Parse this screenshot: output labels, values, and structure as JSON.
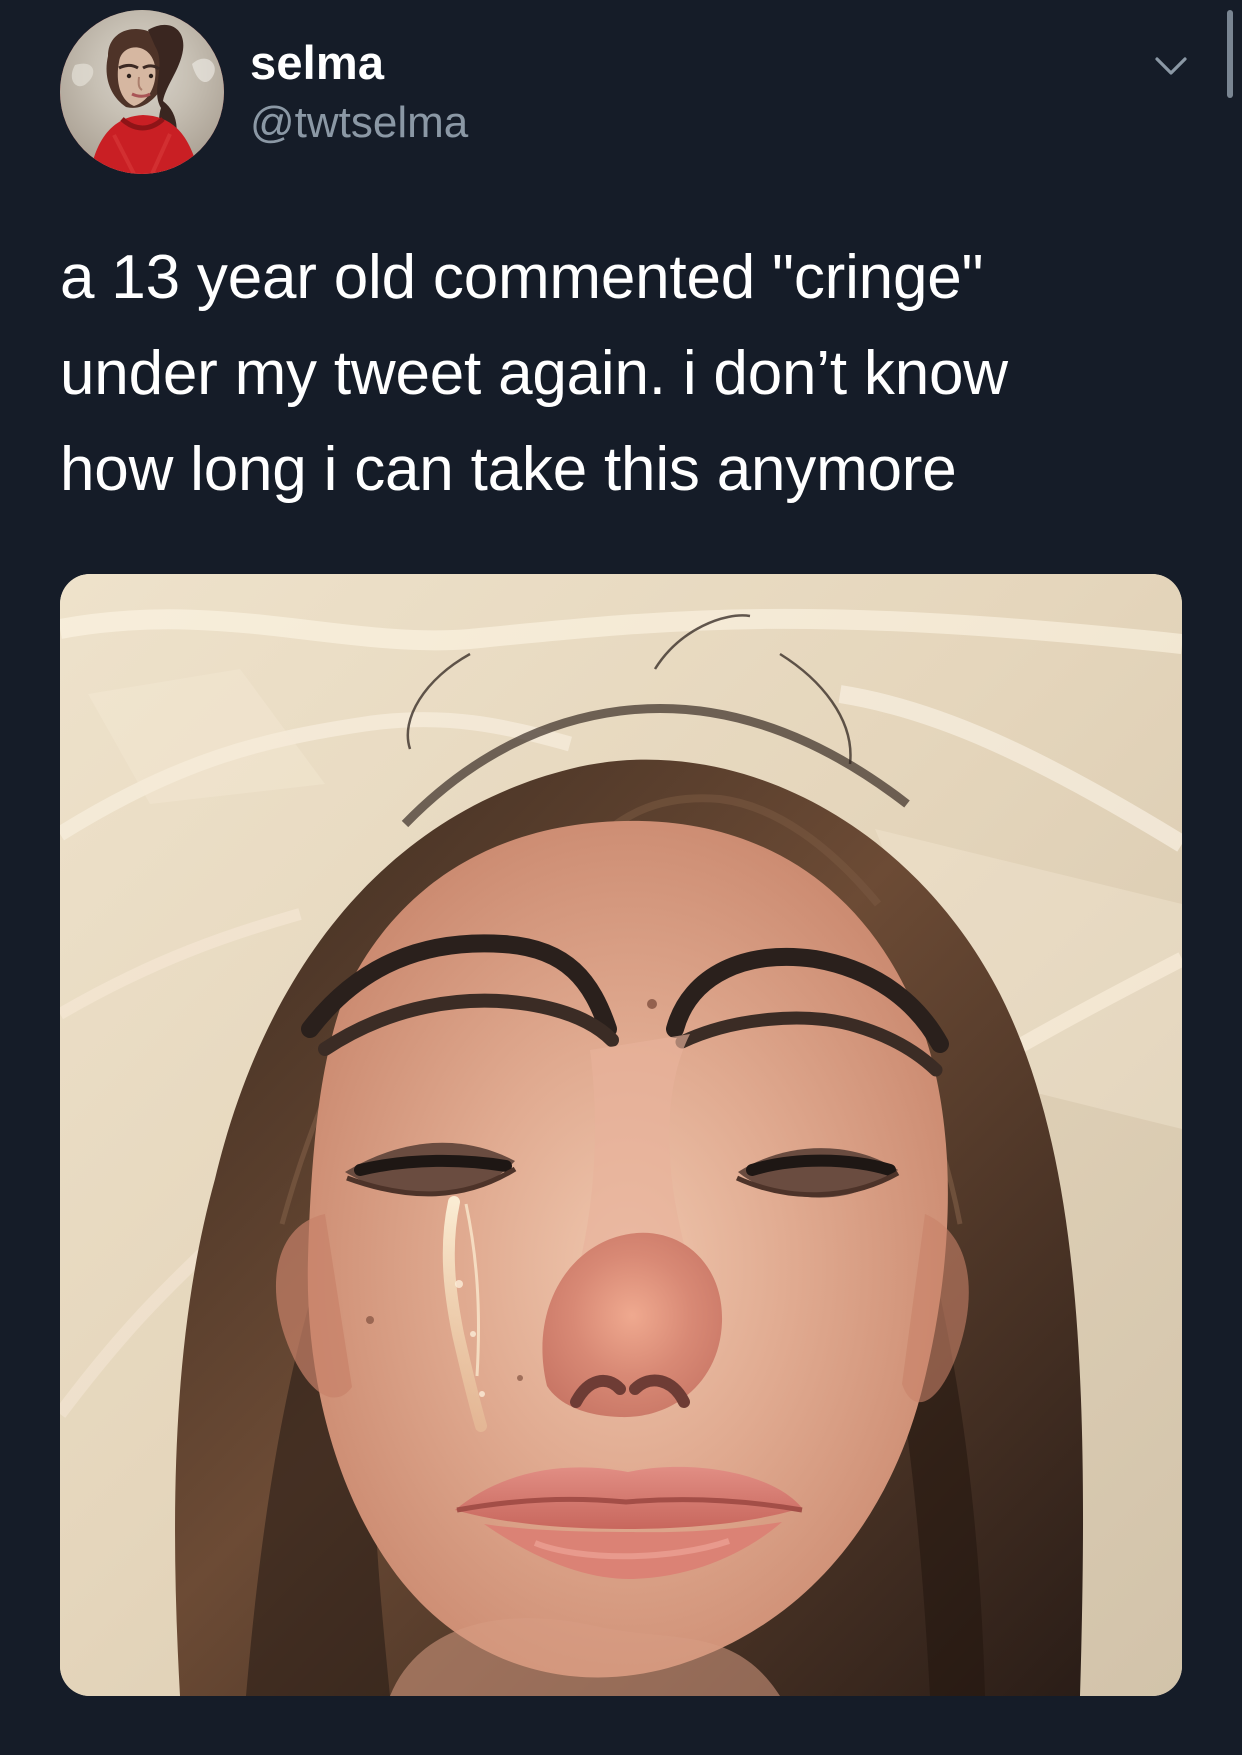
{
  "tweet": {
    "author": {
      "display_name": "selma",
      "handle": "@twtselma"
    },
    "text_lines": [
      "a 13 year old commented \"cringe\"",
      "under my tweet again. i don’t know",
      "how long i can take this anymore"
    ],
    "media": {
      "type": "photo"
    },
    "menu_icon": "chevron-down-icon"
  },
  "theme": {
    "background": "#151c28",
    "primary_text": "#ffffff",
    "secondary_text": "#8b98a5"
  }
}
